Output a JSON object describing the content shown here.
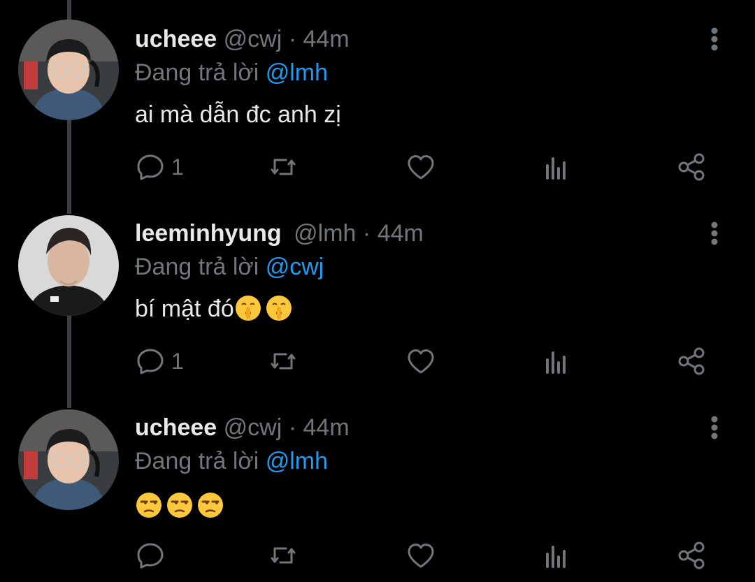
{
  "tweets": [
    {
      "display_name": "ucheee",
      "handle": "@cwj",
      "separator": "·",
      "time": "44m",
      "replying_to_label": "Đang trả lời",
      "replying_to_mention": "@lmh",
      "text": "ai mà dẫn đc anh zị",
      "emojis": [],
      "reply_count": "1",
      "avatar_icon": "user-photo-glasses-headset"
    },
    {
      "display_name": "leeminhyung",
      "handle": "@lmh",
      "separator": "·",
      "time": "44m",
      "replying_to_label": "Đang trả lời",
      "replying_to_mention": "@cwj",
      "text": "bí mật đó",
      "emojis": [
        "shushing-face",
        "shushing-face"
      ],
      "reply_count": "1",
      "avatar_icon": "user-photo-black-jacket"
    },
    {
      "display_name": "ucheee",
      "handle": "@cwj",
      "separator": "·",
      "time": "44m",
      "replying_to_label": "Đang trả lời",
      "replying_to_mention": "@lmh",
      "text": "",
      "emojis": [
        "unamused-face",
        "unamused-face",
        "unamused-face"
      ],
      "reply_count": "",
      "avatar_icon": "user-photo-glasses-headset"
    }
  ],
  "icons": {
    "reply": "reply-icon",
    "retweet": "retweet-icon",
    "like": "heart-icon",
    "views": "views-icon",
    "share": "share-icon",
    "more": "more-vertical-icon"
  },
  "colors": {
    "background": "#000000",
    "text_primary": "#e7e9ea",
    "text_secondary": "#71767b",
    "accent": "#1d9bf0",
    "thread_line": "#3d4146"
  }
}
